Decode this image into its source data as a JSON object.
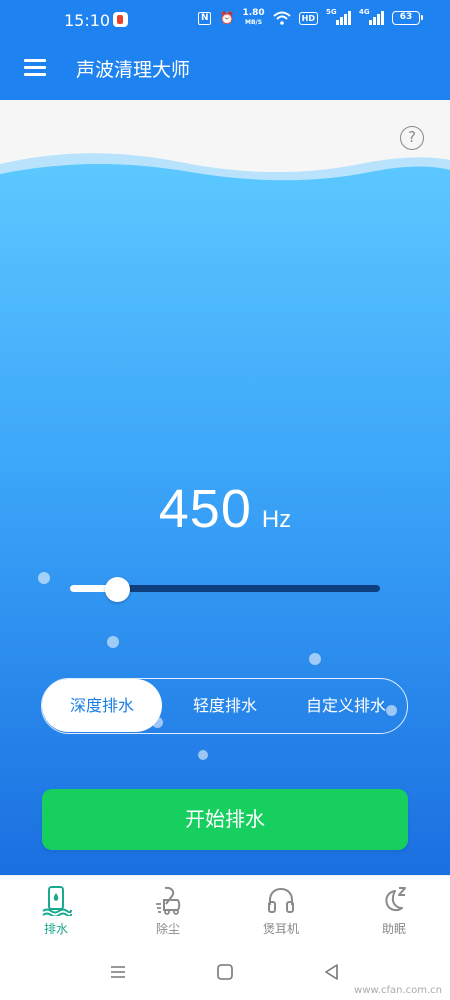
{
  "status_bar": {
    "time": "15:10",
    "network_speed_value": "1.80",
    "network_speed_unit": "MB/S",
    "hd_label": "HD",
    "signal_1_label": "5G",
    "signal_2_label": "4G",
    "battery_level": "63",
    "nfc_glyph": "N",
    "alarm_glyph": "⏰",
    "wifi_glyph": "◠"
  },
  "app_bar": {
    "title": "声波清理大师",
    "menu_icon": "hamburger-menu-icon"
  },
  "main": {
    "help_icon_glyph": "?",
    "frequency_value": "450",
    "frequency_unit": "Hz",
    "frequency_slider_fraction": 0.15,
    "mode_options": [
      "深度排水",
      "轻度排水",
      "自定义排水"
    ],
    "selected_mode": "深度排水",
    "start_button_label": "开始排水"
  },
  "bottom_nav": {
    "items": [
      {
        "label": "排水",
        "icon": "drain-phone-icon"
      },
      {
        "label": "除尘",
        "icon": "vacuum-icon"
      },
      {
        "label": "煲耳机",
        "icon": "headphones-icon"
      },
      {
        "label": "助眠",
        "icon": "moon-sleep-icon"
      }
    ],
    "active_index": 0
  },
  "system_nav": {
    "watermark": "www.cfan.com.cn"
  },
  "colors": {
    "app_bar": "#1e82f0",
    "water_top": "#5cc8ff",
    "water_bottom": "#1a6fe0",
    "start_button": "#16cf5f",
    "active_nav": "#1aa98e",
    "inactive_nav": "#8a8a8a"
  }
}
